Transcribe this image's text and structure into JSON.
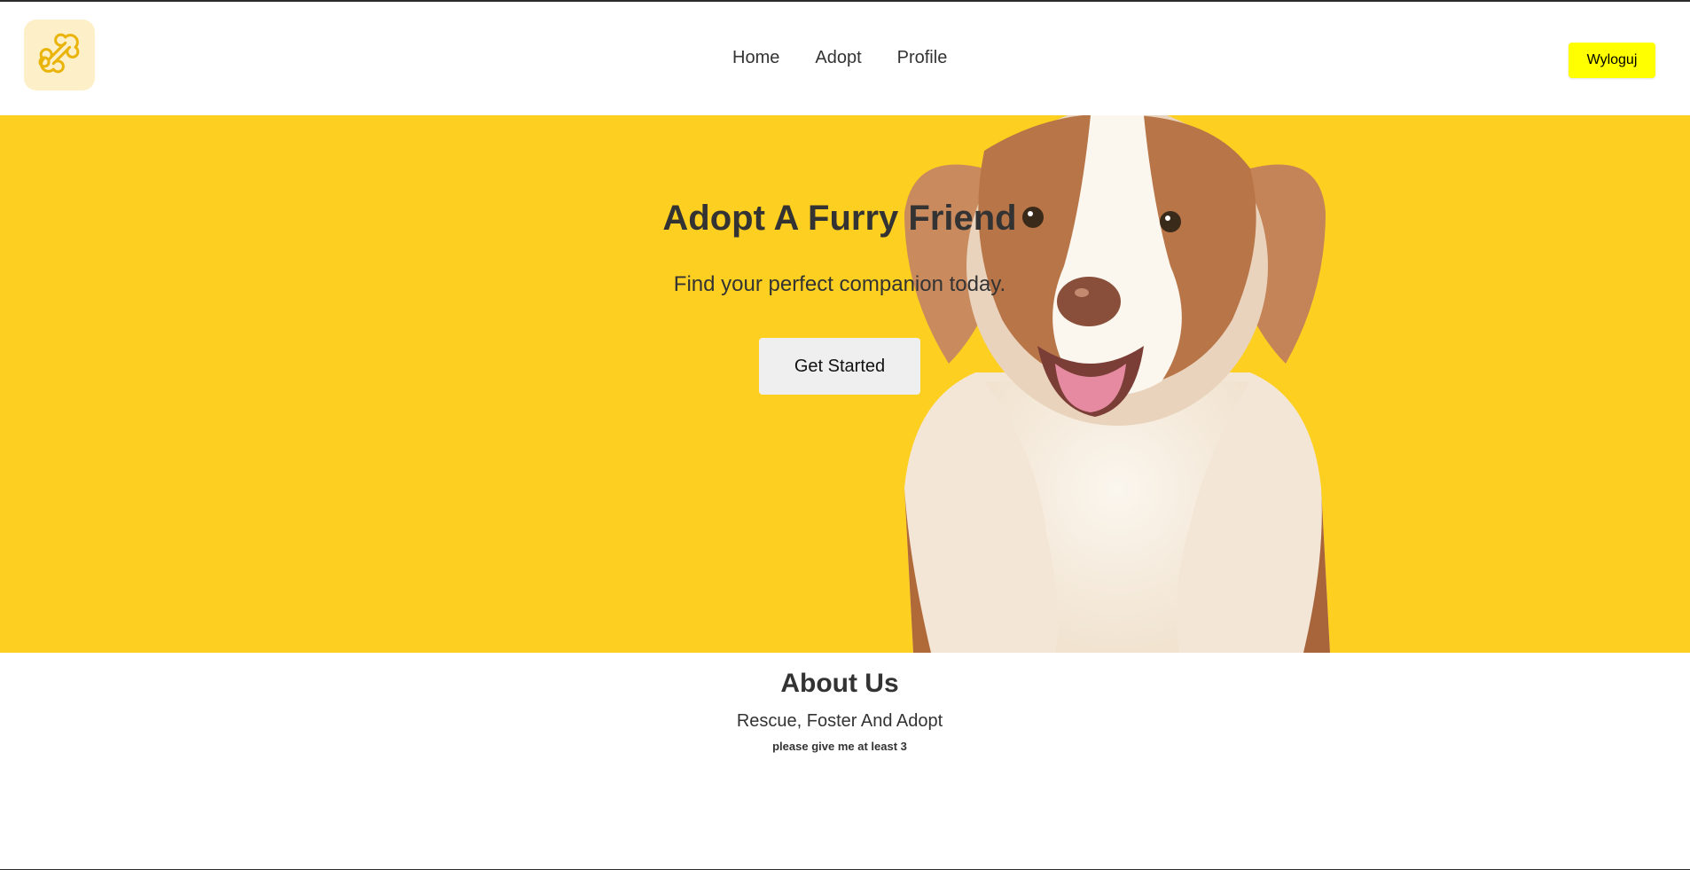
{
  "header": {
    "logo_icon": "bone-icon",
    "nav": {
      "home": "Home",
      "adopt": "Adopt",
      "profile": "Profile"
    },
    "logout_label": "Wyloguj"
  },
  "hero": {
    "title": "Adopt A Furry Friend",
    "subtitle": "Find your perfect companion today.",
    "cta_label": "Get Started",
    "image": "dog-photo",
    "background_color": "#fdcf20"
  },
  "about": {
    "title": "About Us",
    "subtitle": "Rescue, Foster And Adopt",
    "note": "please give me at least 3"
  },
  "colors": {
    "accent": "#fdcf20",
    "logout_button": "#ffff00",
    "text": "#333333"
  }
}
